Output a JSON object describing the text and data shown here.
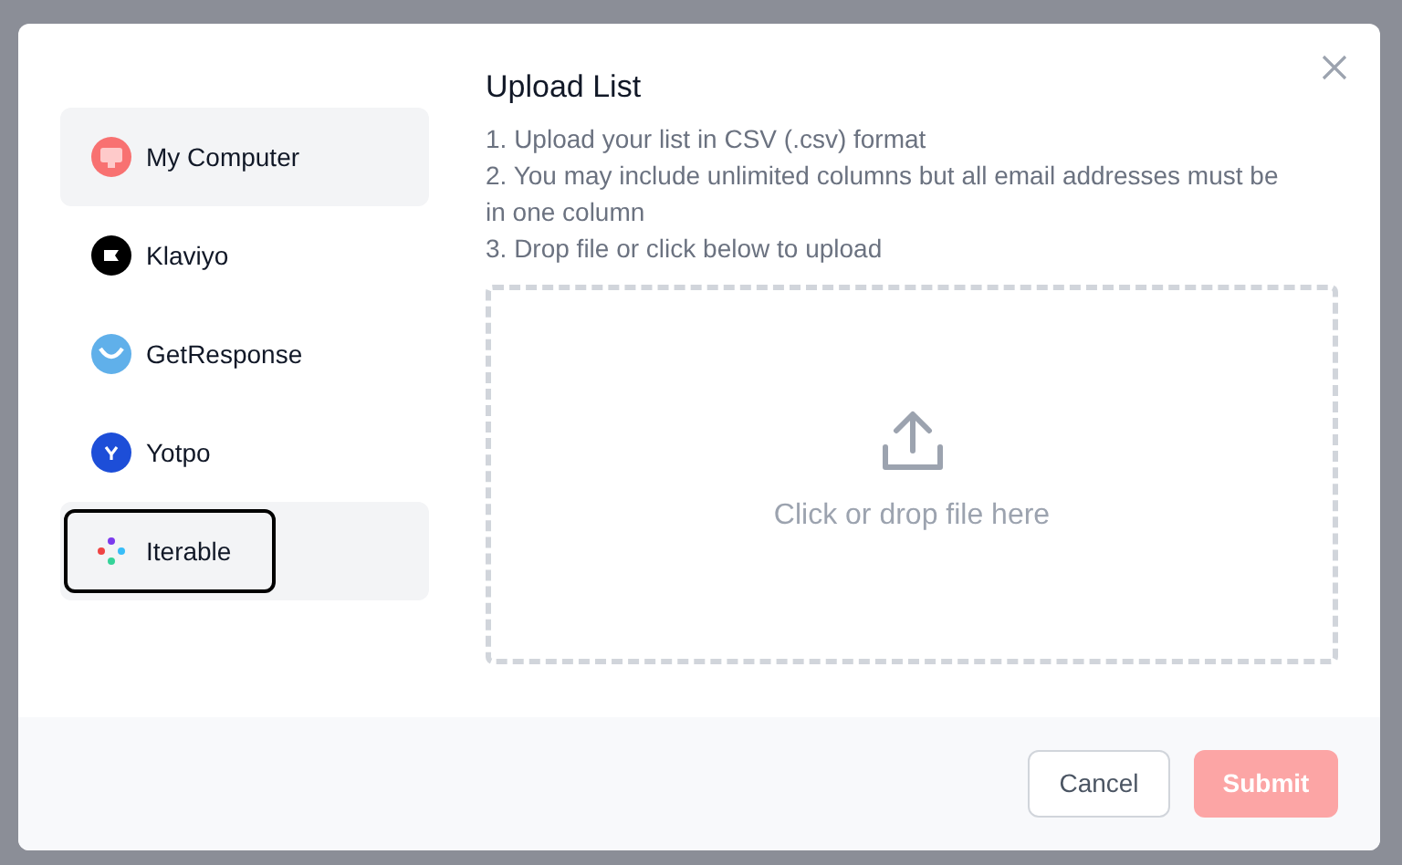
{
  "sources": [
    {
      "label": "My Computer",
      "kind": "computer",
      "selected": true,
      "focused": false
    },
    {
      "label": "Klaviyo",
      "kind": "klaviyo",
      "selected": false,
      "focused": false
    },
    {
      "label": "GetResponse",
      "kind": "getresponse",
      "selected": false,
      "focused": false
    },
    {
      "label": "Yotpo",
      "kind": "yotpo",
      "selected": false,
      "focused": false
    },
    {
      "label": "Iterable",
      "kind": "iterable",
      "selected": true,
      "focused": true
    }
  ],
  "title": "Upload List",
  "instructions": [
    "1. Upload your list in CSV (.csv) format",
    "2. You may include unlimited columns but all email addresses must be in one column",
    "3. Drop file or click below to upload"
  ],
  "dropzone": {
    "text": "Click or drop file here"
  },
  "buttons": [
    {
      "label": "Cancel",
      "kind": "secondary",
      "disabled": false
    },
    {
      "label": "Submit",
      "kind": "primary",
      "disabled": true
    }
  ]
}
